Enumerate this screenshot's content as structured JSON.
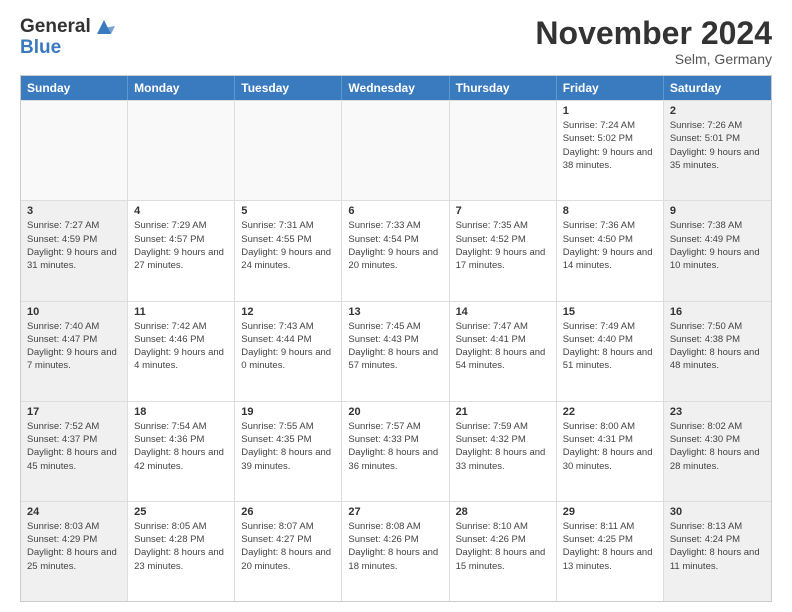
{
  "header": {
    "logo_line1": "General",
    "logo_line2": "Blue",
    "month": "November 2024",
    "location": "Selm, Germany"
  },
  "weekdays": [
    "Sunday",
    "Monday",
    "Tuesday",
    "Wednesday",
    "Thursday",
    "Friday",
    "Saturday"
  ],
  "rows": [
    [
      {
        "day": "",
        "empty": true
      },
      {
        "day": "",
        "empty": true
      },
      {
        "day": "",
        "empty": true
      },
      {
        "day": "",
        "empty": true
      },
      {
        "day": "",
        "empty": true
      },
      {
        "day": "1",
        "sunrise": "Sunrise: 7:24 AM",
        "sunset": "Sunset: 5:02 PM",
        "daylight": "Daylight: 9 hours and 38 minutes."
      },
      {
        "day": "2",
        "sunrise": "Sunrise: 7:26 AM",
        "sunset": "Sunset: 5:01 PM",
        "daylight": "Daylight: 9 hours and 35 minutes."
      }
    ],
    [
      {
        "day": "3",
        "sunrise": "Sunrise: 7:27 AM",
        "sunset": "Sunset: 4:59 PM",
        "daylight": "Daylight: 9 hours and 31 minutes."
      },
      {
        "day": "4",
        "sunrise": "Sunrise: 7:29 AM",
        "sunset": "Sunset: 4:57 PM",
        "daylight": "Daylight: 9 hours and 27 minutes."
      },
      {
        "day": "5",
        "sunrise": "Sunrise: 7:31 AM",
        "sunset": "Sunset: 4:55 PM",
        "daylight": "Daylight: 9 hours and 24 minutes."
      },
      {
        "day": "6",
        "sunrise": "Sunrise: 7:33 AM",
        "sunset": "Sunset: 4:54 PM",
        "daylight": "Daylight: 9 hours and 20 minutes."
      },
      {
        "day": "7",
        "sunrise": "Sunrise: 7:35 AM",
        "sunset": "Sunset: 4:52 PM",
        "daylight": "Daylight: 9 hours and 17 minutes."
      },
      {
        "day": "8",
        "sunrise": "Sunrise: 7:36 AM",
        "sunset": "Sunset: 4:50 PM",
        "daylight": "Daylight: 9 hours and 14 minutes."
      },
      {
        "day": "9",
        "sunrise": "Sunrise: 7:38 AM",
        "sunset": "Sunset: 4:49 PM",
        "daylight": "Daylight: 9 hours and 10 minutes."
      }
    ],
    [
      {
        "day": "10",
        "sunrise": "Sunrise: 7:40 AM",
        "sunset": "Sunset: 4:47 PM",
        "daylight": "Daylight: 9 hours and 7 minutes."
      },
      {
        "day": "11",
        "sunrise": "Sunrise: 7:42 AM",
        "sunset": "Sunset: 4:46 PM",
        "daylight": "Daylight: 9 hours and 4 minutes."
      },
      {
        "day": "12",
        "sunrise": "Sunrise: 7:43 AM",
        "sunset": "Sunset: 4:44 PM",
        "daylight": "Daylight: 9 hours and 0 minutes."
      },
      {
        "day": "13",
        "sunrise": "Sunrise: 7:45 AM",
        "sunset": "Sunset: 4:43 PM",
        "daylight": "Daylight: 8 hours and 57 minutes."
      },
      {
        "day": "14",
        "sunrise": "Sunrise: 7:47 AM",
        "sunset": "Sunset: 4:41 PM",
        "daylight": "Daylight: 8 hours and 54 minutes."
      },
      {
        "day": "15",
        "sunrise": "Sunrise: 7:49 AM",
        "sunset": "Sunset: 4:40 PM",
        "daylight": "Daylight: 8 hours and 51 minutes."
      },
      {
        "day": "16",
        "sunrise": "Sunrise: 7:50 AM",
        "sunset": "Sunset: 4:38 PM",
        "daylight": "Daylight: 8 hours and 48 minutes."
      }
    ],
    [
      {
        "day": "17",
        "sunrise": "Sunrise: 7:52 AM",
        "sunset": "Sunset: 4:37 PM",
        "daylight": "Daylight: 8 hours and 45 minutes."
      },
      {
        "day": "18",
        "sunrise": "Sunrise: 7:54 AM",
        "sunset": "Sunset: 4:36 PM",
        "daylight": "Daylight: 8 hours and 42 minutes."
      },
      {
        "day": "19",
        "sunrise": "Sunrise: 7:55 AM",
        "sunset": "Sunset: 4:35 PM",
        "daylight": "Daylight: 8 hours and 39 minutes."
      },
      {
        "day": "20",
        "sunrise": "Sunrise: 7:57 AM",
        "sunset": "Sunset: 4:33 PM",
        "daylight": "Daylight: 8 hours and 36 minutes."
      },
      {
        "day": "21",
        "sunrise": "Sunrise: 7:59 AM",
        "sunset": "Sunset: 4:32 PM",
        "daylight": "Daylight: 8 hours and 33 minutes."
      },
      {
        "day": "22",
        "sunrise": "Sunrise: 8:00 AM",
        "sunset": "Sunset: 4:31 PM",
        "daylight": "Daylight: 8 hours and 30 minutes."
      },
      {
        "day": "23",
        "sunrise": "Sunrise: 8:02 AM",
        "sunset": "Sunset: 4:30 PM",
        "daylight": "Daylight: 8 hours and 28 minutes."
      }
    ],
    [
      {
        "day": "24",
        "sunrise": "Sunrise: 8:03 AM",
        "sunset": "Sunset: 4:29 PM",
        "daylight": "Daylight: 8 hours and 25 minutes."
      },
      {
        "day": "25",
        "sunrise": "Sunrise: 8:05 AM",
        "sunset": "Sunset: 4:28 PM",
        "daylight": "Daylight: 8 hours and 23 minutes."
      },
      {
        "day": "26",
        "sunrise": "Sunrise: 8:07 AM",
        "sunset": "Sunset: 4:27 PM",
        "daylight": "Daylight: 8 hours and 20 minutes."
      },
      {
        "day": "27",
        "sunrise": "Sunrise: 8:08 AM",
        "sunset": "Sunset: 4:26 PM",
        "daylight": "Daylight: 8 hours and 18 minutes."
      },
      {
        "day": "28",
        "sunrise": "Sunrise: 8:10 AM",
        "sunset": "Sunset: 4:26 PM",
        "daylight": "Daylight: 8 hours and 15 minutes."
      },
      {
        "day": "29",
        "sunrise": "Sunrise: 8:11 AM",
        "sunset": "Sunset: 4:25 PM",
        "daylight": "Daylight: 8 hours and 13 minutes."
      },
      {
        "day": "30",
        "sunrise": "Sunrise: 8:13 AM",
        "sunset": "Sunset: 4:24 PM",
        "daylight": "Daylight: 8 hours and 11 minutes."
      }
    ]
  ]
}
